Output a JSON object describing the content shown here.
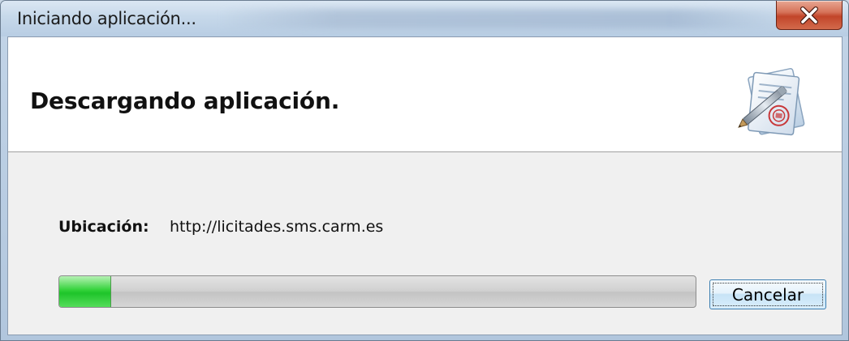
{
  "window": {
    "title": "Iniciando aplicación..."
  },
  "header": {
    "title": "Descargando aplicación.",
    "icon": "document-certificate-pen-icon"
  },
  "location": {
    "label": "Ubicación:",
    "value": "http://licitades.sms.carm.es"
  },
  "progress": {
    "fraction": 0.08,
    "fill_color": "#22c52d"
  },
  "buttons": {
    "cancel_label": "Cancelar",
    "close_icon": "close-icon"
  },
  "colors": {
    "close_button": "#c2452a",
    "focused_button_border": "#3c7fb1"
  }
}
